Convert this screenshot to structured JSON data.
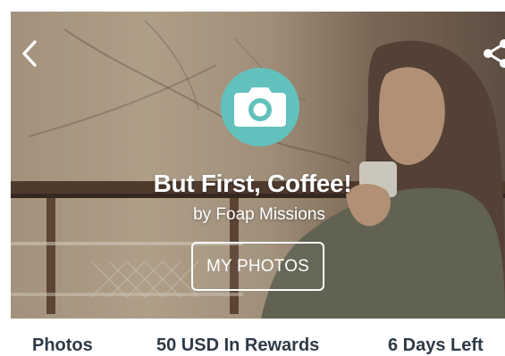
{
  "hero": {
    "title": "But First, Coffee!",
    "author": "by Foap Missions",
    "button_label": "MY PHOTOS"
  },
  "nav": {
    "back_icon": "chevron-left-icon",
    "share_icon": "share-icon"
  },
  "badge": {
    "icon": "camera-icon",
    "color": "#63c1bd"
  },
  "stats": {
    "photos": "Photos",
    "rewards": "50 USD In Rewards",
    "days_left": "6 Days Left"
  }
}
